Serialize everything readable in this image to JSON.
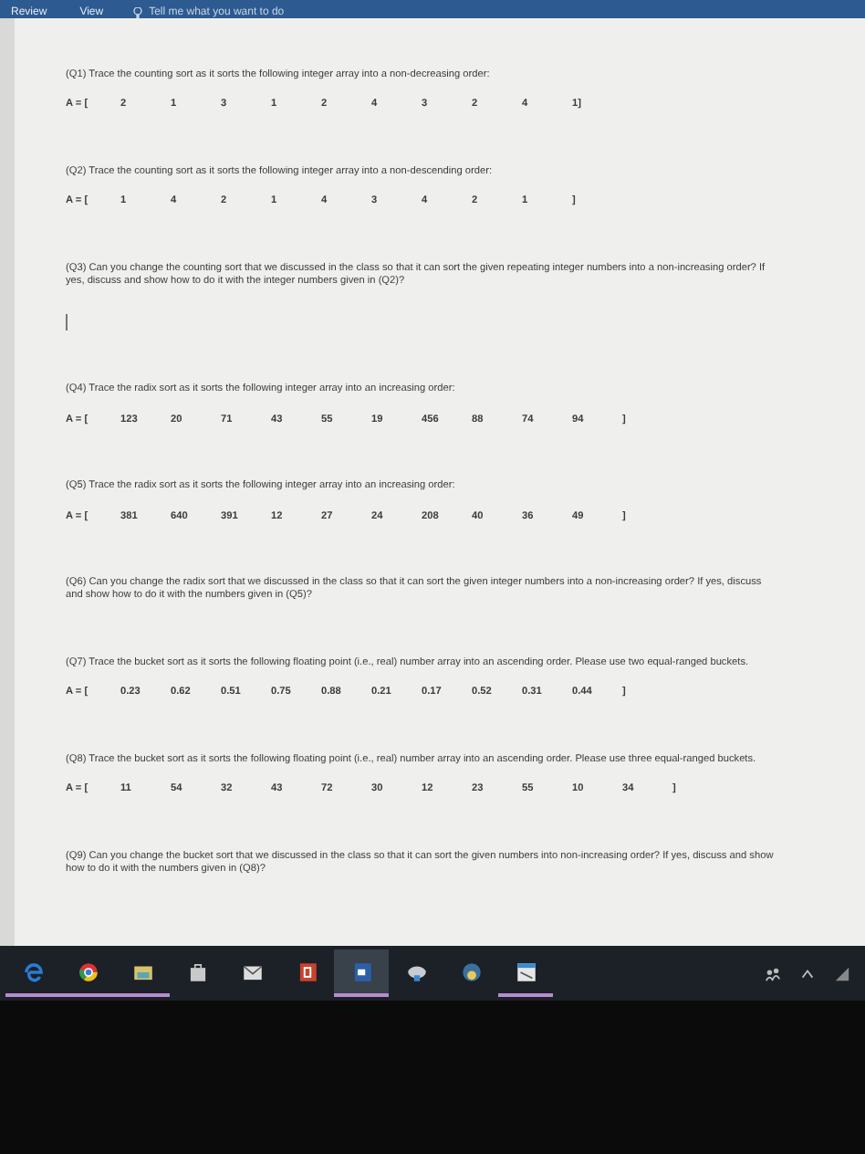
{
  "ribbon": {
    "tabs": [
      {
        "label": "Review",
        "selected": false
      },
      {
        "label": "View",
        "selected": false
      }
    ],
    "tell_me": "Tell me what you want to do"
  },
  "questions": [
    {
      "prompt": "(Q1) Trace the counting sort as it sorts the following integer array into a non-decreasing order:",
      "array": {
        "label": "A = [",
        "values": [
          "2",
          "1",
          "3",
          "1",
          "2",
          "4",
          "3",
          "2",
          "4",
          "1]"
        ]
      }
    },
    {
      "prompt": "(Q2) Trace the counting sort as it sorts the following integer array into a non-descending order:",
      "array": {
        "label": "A = [",
        "values": [
          "1",
          "4",
          "2",
          "1",
          "4",
          "3",
          "4",
          "2",
          "1",
          "]"
        ]
      }
    },
    {
      "prompt": "(Q3) Can you change the counting sort that we discussed in the class so that it can sort the given repeating integer numbers into a non-increasing order? If yes, discuss and show how to do it with the integer numbers given in (Q2)?",
      "cursor": true
    },
    {
      "prompt": "(Q4) Trace the radix sort as it sorts the following integer array into an increasing order:",
      "array": {
        "label": "A = [",
        "values": [
          "123",
          "20",
          "71",
          "43",
          "55",
          "19",
          "456",
          "88",
          "74",
          "94",
          "]"
        ]
      }
    },
    {
      "prompt": "(Q5) Trace the radix sort as it sorts the following integer array into an increasing order:",
      "array": {
        "label": "A = [",
        "values": [
          "381",
          "640",
          "391",
          "12",
          "27",
          "24",
          "208",
          "40",
          "36",
          "49",
          "]"
        ]
      }
    },
    {
      "prompt": "(Q6) Can you change the radix sort that we discussed in the class so that it can sort the given integer numbers into a non-increasing order? If yes, discuss and show how to do it with the numbers given in (Q5)?"
    },
    {
      "prompt": "(Q7) Trace the bucket sort as it sorts the following floating point (i.e., real) number array into an ascending order. Please use two equal-ranged buckets.",
      "array": {
        "label": "A = [",
        "values": [
          "0.23",
          "0.62",
          "0.51",
          "0.75",
          "0.88",
          "0.21",
          "0.17",
          "0.52",
          "0.31",
          "0.44",
          "]"
        ]
      }
    },
    {
      "prompt": "(Q8) Trace the bucket sort as it sorts the following floating point (i.e., real) number array into an ascending order. Please use three equal-ranged buckets.",
      "array": {
        "label": "A = [",
        "values": [
          "11",
          "54",
          "32",
          "43",
          "72",
          "30",
          "12",
          "23",
          "55",
          "10",
          "34",
          "]"
        ]
      }
    },
    {
      "prompt": "(Q9) Can you change the bucket sort that we discussed in the class so that it can sort the given numbers into non-increasing order? If yes, discuss and show how to do it with the numbers given in (Q8)?"
    }
  ],
  "taskbar": {
    "apps": [
      {
        "kind": "edge",
        "running": true,
        "selected": false
      },
      {
        "kind": "chrome",
        "running": true,
        "selected": false
      },
      {
        "kind": "files",
        "running": true,
        "selected": false
      },
      {
        "kind": "store",
        "running": false,
        "selected": false
      },
      {
        "kind": "mail",
        "running": false,
        "selected": false
      },
      {
        "kind": "powerpoint",
        "running": false,
        "selected": false
      },
      {
        "kind": "word",
        "running": true,
        "selected": true
      },
      {
        "kind": "cloud",
        "running": false,
        "selected": false
      },
      {
        "kind": "python",
        "running": false,
        "selected": false
      },
      {
        "kind": "editor",
        "running": true,
        "selected": false
      }
    ]
  }
}
